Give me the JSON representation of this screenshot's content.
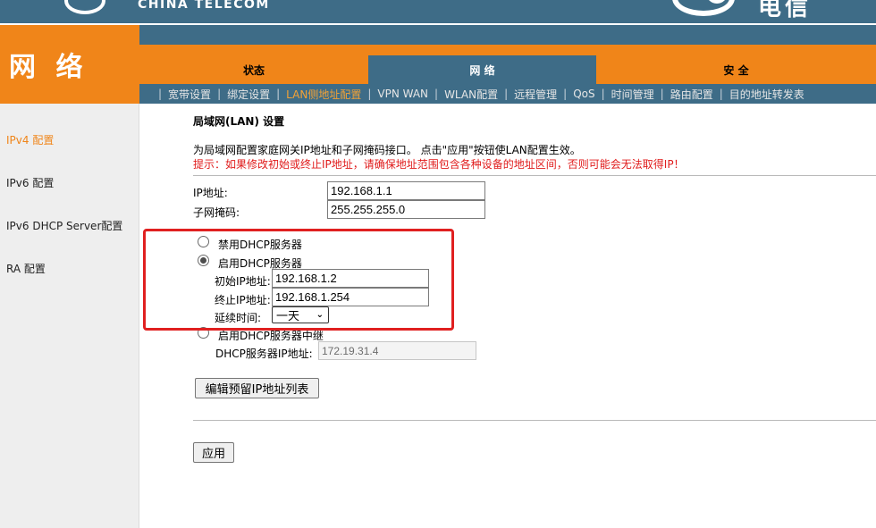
{
  "brand": {
    "name": "CHINA TELECOM",
    "chars": "电信"
  },
  "section": {
    "title": "网 络"
  },
  "tabs": [
    {
      "label": "状态"
    },
    {
      "label": "网 络"
    },
    {
      "label": "安 全"
    }
  ],
  "subnav": [
    {
      "label": "宽带设置"
    },
    {
      "label": "绑定设置"
    },
    {
      "label": "LAN侧地址配置"
    },
    {
      "label": "VPN WAN"
    },
    {
      "label": "WLAN配置"
    },
    {
      "label": "远程管理"
    },
    {
      "label": "QoS"
    },
    {
      "label": "时间管理"
    },
    {
      "label": "路由配置"
    },
    {
      "label": "目的地址转发表"
    }
  ],
  "sidebar": {
    "items": [
      {
        "label": "IPv4 配置"
      },
      {
        "label": "IPv6 配置"
      },
      {
        "label": "IPv6 DHCP Server配置"
      },
      {
        "label": "RA 配置"
      }
    ]
  },
  "main": {
    "title": "局域网(LAN) 设置",
    "description": "为局域网配置家庭网关IP地址和子网掩码接口。 点击\"应用\"按钮使LAN配置生效。",
    "hint": "提示：如果修改初始或终止IP地址，请确保地址范围包含各种设备的地址区间，否则可能会无法取得IP！",
    "ip_label": "IP地址:",
    "ip_value": "192.168.1.1",
    "mask_label": "子网掩码:",
    "mask_value": "255.255.255.0",
    "dhcp": {
      "disable_label": "禁用DHCP服务器",
      "enable_label": "启用DHCP服务器",
      "relay_label": "启用DHCP服务器中继",
      "start_label": "初始IP地址:",
      "start_value": "192.168.1.2",
      "end_label": "终止IP地址:",
      "end_value": "192.168.1.254",
      "lease_label": "延续时间:",
      "lease_value": "一天",
      "server_ip_label": "DHCP服务器IP地址:",
      "server_ip_value": "172.19.31.4",
      "selected": "enable"
    },
    "edit_reserved_button": "编辑预留IP地址列表",
    "apply_button": "应用"
  },
  "colors": {
    "orange": "#f08519",
    "teal": "#3e6c87",
    "highlight": "#e02020",
    "hint_red": "#e01b1b"
  }
}
